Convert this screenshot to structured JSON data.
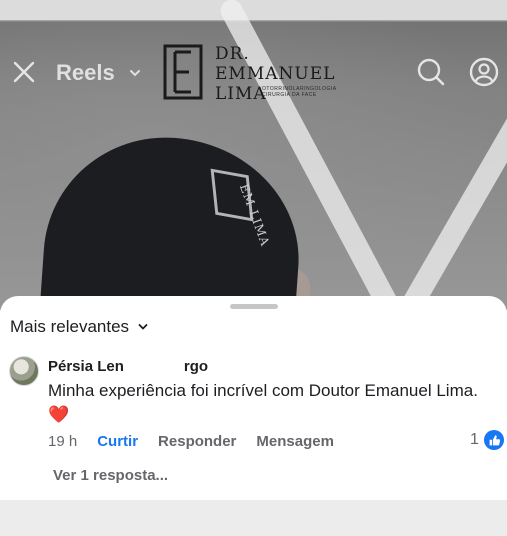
{
  "header": {
    "reels_label": "Reels",
    "brand": {
      "line1": "DR.",
      "line2": "EMMANUEL",
      "line3": "LIMA",
      "subtitle_line1": "OTORRINOLARINGOLOGIA",
      "subtitle_line2": "CIRURGIA DA FACE"
    }
  },
  "comments": {
    "sort_label": "Mais relevantes",
    "items": [
      {
        "author": "Pérsia Len                    rgo",
        "text": "Minha experiência foi incrível com Doutor Emanuel Lima.",
        "emoji": "❤️",
        "time": "19 h",
        "like_label": "Curtir",
        "reply_label": "Responder",
        "message_label": "Mensagem",
        "like_count": "1",
        "view_replies": "Ver 1 resposta..."
      }
    ]
  },
  "colors": {
    "accent": "#1877f2",
    "heart": "#d0282e",
    "text_primary": "#1c1e21",
    "text_secondary": "#65676b"
  },
  "icons": [
    "close-icon",
    "chevron-down-icon",
    "search-icon",
    "profile-icon",
    "thumbs-up-icon"
  ]
}
